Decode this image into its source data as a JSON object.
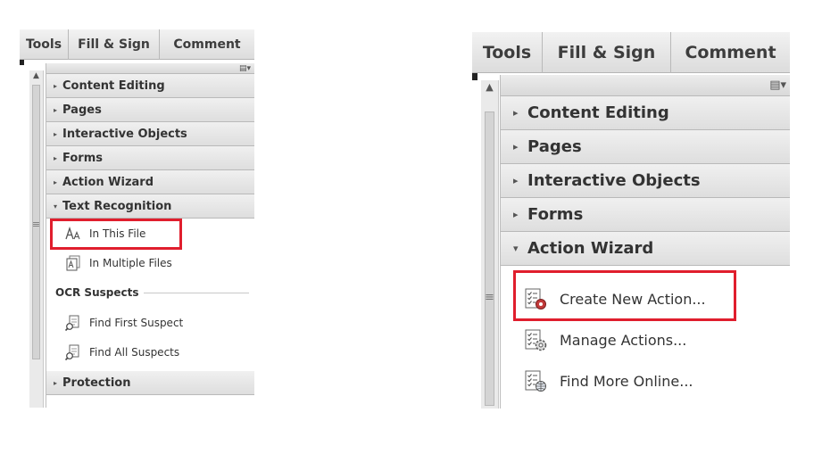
{
  "left_panel": {
    "tabs": [
      "Tools",
      "Fill & Sign",
      "Comment"
    ],
    "sections_top": [
      "Content Editing",
      "Pages",
      "Interactive Objects",
      "Forms",
      "Action Wizard"
    ],
    "expanded_section": "Text Recognition",
    "items": [
      "In This File",
      "In Multiple Files"
    ],
    "ocr_header": "OCR Suspects",
    "ocr_items": [
      "Find First Suspect",
      "Find All Suspects"
    ],
    "sections_bottom": [
      "Protection"
    ]
  },
  "right_panel": {
    "tabs": [
      "Tools",
      "Fill & Sign",
      "Comment"
    ],
    "sections_top": [
      "Content Editing",
      "Pages",
      "Interactive Objects",
      "Forms"
    ],
    "expanded_section": "Action Wizard",
    "items": [
      "Create New Action...",
      "Manage Actions...",
      "Find More Online..."
    ]
  },
  "icons": {
    "collapsed_arrow": "▸",
    "expanded_arrow": "▾",
    "scroll_up": "▲",
    "scroll_grip": "≡",
    "options_menu": "▤▾"
  },
  "colors": {
    "highlight": "#e01e2d"
  }
}
